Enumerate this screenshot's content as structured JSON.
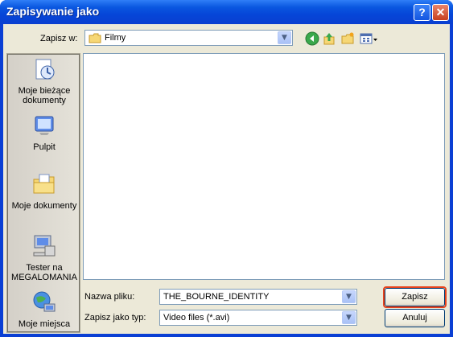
{
  "window": {
    "title": "Zapisywanie jako",
    "help_glyph": "?",
    "close_glyph": "✕"
  },
  "lookin": {
    "label": "Zapisz w:",
    "value": "Filmy"
  },
  "toolbar": {
    "icons": [
      "back-icon",
      "up-folder-icon",
      "new-folder-icon",
      "view-menu-icon"
    ]
  },
  "places": [
    {
      "label": "Moje bieżące dokumenty",
      "icon": "recent-documents-icon"
    },
    {
      "label": "Pulpit",
      "icon": "desktop-icon"
    },
    {
      "label": "Moje dokumenty",
      "icon": "my-documents-icon"
    },
    {
      "label": "Tester na MEGALOMANIA",
      "icon": "my-computer-icon"
    },
    {
      "label": "Moje miejsca",
      "icon": "network-places-icon"
    }
  ],
  "filename": {
    "label": "Nazwa pliku:",
    "value": "THE_BOURNE_IDENTITY"
  },
  "filetype": {
    "label": "Zapisz jako typ:",
    "value": "Video files (*.avi)"
  },
  "buttons": {
    "save": "Zapisz",
    "cancel": "Anuluj"
  },
  "colors": {
    "titlebar": "#0a57e0",
    "dialog_bg": "#ece9d8",
    "focus_ring": "#e6421c"
  }
}
